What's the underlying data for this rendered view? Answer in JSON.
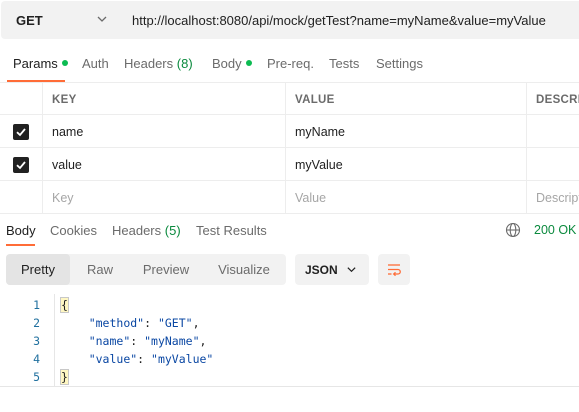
{
  "request": {
    "method": "GET",
    "url": "http://localhost:8080/api/mock/getTest?name=myName&value=myValue"
  },
  "request_tabs": {
    "params": "Params",
    "auth": "Auth",
    "headers": "Headers",
    "headers_count": "(8)",
    "body": "Body",
    "prereq": "Pre-req.",
    "tests": "Tests",
    "settings": "Settings"
  },
  "params_table": {
    "headers": {
      "key": "KEY",
      "value": "VALUE",
      "description": "DESCRIPTION"
    },
    "rows": [
      {
        "checked": true,
        "key": "name",
        "value": "myName"
      },
      {
        "checked": true,
        "key": "value",
        "value": "myValue"
      }
    ],
    "placeholder": {
      "key": "Key",
      "value": "Value",
      "description": "Description"
    }
  },
  "response_tabs": {
    "body": "Body",
    "cookies": "Cookies",
    "headers": "Headers",
    "headers_count": "(5)",
    "test_results": "Test Results",
    "status": "200 OK"
  },
  "view_toolbar": {
    "modes": [
      "Pretty",
      "Raw",
      "Preview",
      "Visualize"
    ],
    "active_mode": "Pretty",
    "format": "JSON"
  },
  "response_body": {
    "line_numbers": [
      "1",
      "2",
      "3",
      "4",
      "5"
    ],
    "open_brace": "{",
    "close_brace": "}",
    "entries": [
      {
        "key": "\"method\"",
        "value": "\"GET\"",
        "sep": ","
      },
      {
        "key": "\"name\"",
        "value": "\"myName\"",
        "sep": ","
      },
      {
        "key": "\"value\"",
        "value": "\"myValue\"",
        "sep": ""
      }
    ]
  },
  "colors": {
    "accent_underline": "#ff6c37",
    "status_green": "#0b8a3e",
    "modified_dot": "#0cbb52",
    "json_key_value": "#0a47a3",
    "line_number": "#1f6f9e"
  },
  "icons": {
    "method_dropdown": "chevron-down-icon",
    "status_network": "globe-icon",
    "format_dropdown": "chevron-down-icon",
    "wrap_lines": "wrap-lines-icon",
    "row_checkbox": "checkmark-icon"
  }
}
